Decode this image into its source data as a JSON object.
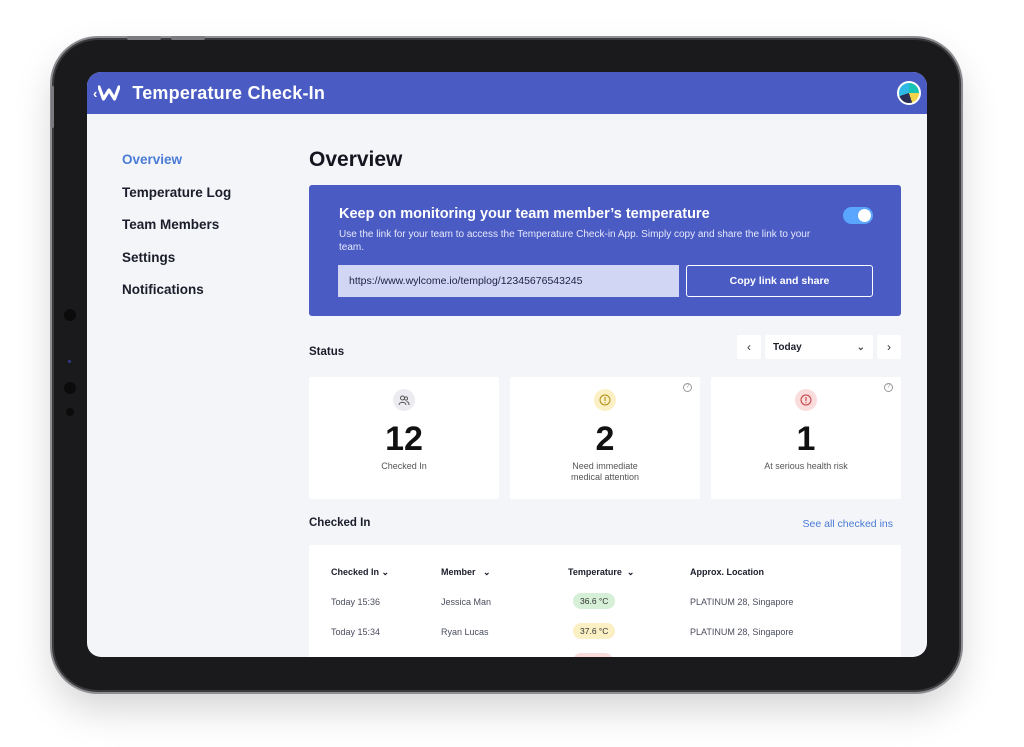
{
  "app": {
    "title": "Temperature Check-In",
    "back_icon": "back-arrow-icon",
    "logo_icon": "w-logo-icon",
    "accent": "#4a5bc4"
  },
  "sidebar": {
    "items": [
      {
        "label": "Overview",
        "active": true
      },
      {
        "label": "Temperature Log",
        "active": false
      },
      {
        "label": "Team Members",
        "active": false
      },
      {
        "label": "Settings",
        "active": false
      },
      {
        "label": "Notifications",
        "active": false
      }
    ]
  },
  "main": {
    "title": "Overview",
    "banner": {
      "title": "Keep on monitoring your team member’s temperature",
      "description": "Use the link for your team to access the Temperature Check-in App. Simply copy and share the link to your team.",
      "link_value": "https://www.wylcome.io/templog/12345676543245",
      "copy_button": "Copy link and share",
      "toggle_on": true
    },
    "status": {
      "label": "Status",
      "date_value": "Today",
      "cards": [
        {
          "number": "12",
          "label": "Checked In",
          "icon": "people-icon",
          "icon_color": "#e9e9ee"
        },
        {
          "number": "2",
          "label": "Need immediate medical attention",
          "icon": "alert-icon",
          "icon_color": "#fbf0c4"
        },
        {
          "number": "1",
          "label": "At serious health risk",
          "icon": "alert-icon",
          "icon_color": "#fbdcdc"
        }
      ]
    },
    "checked_in": {
      "label": "Checked In",
      "see_all": "See all checked ins",
      "columns": [
        "Checked In",
        "Member",
        "Temperature",
        "Approx. Location"
      ],
      "rows": [
        {
          "time": "Today 15:36",
          "member": "Jessica Man",
          "temp": "36.6 °C",
          "temp_color": "#d6efd7",
          "location": "PLATINUM 28, Singapore"
        },
        {
          "time": "Today 15:34",
          "member": "Ryan Lucas",
          "temp": "37.6 °C",
          "temp_color": "#fbf0c4",
          "location": "PLATINUM 28, Singapore"
        }
      ]
    }
  }
}
